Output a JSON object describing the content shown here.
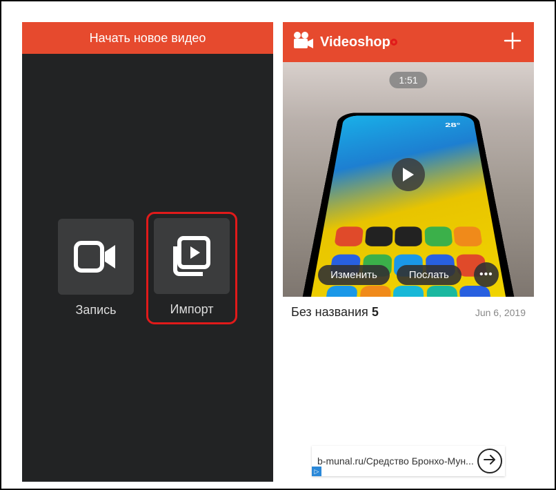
{
  "left": {
    "header_title": "Начать новое видео",
    "record_label": "Запись",
    "import_label": "Импорт"
  },
  "right": {
    "app_name": "Videoshop",
    "video": {
      "duration": "1:51",
      "edit_label": "Изменить",
      "send_label": "Послать",
      "title_prefix": "Без названия ",
      "title_number": "5",
      "date": "Jun 6, 2019",
      "weather": "28°"
    },
    "ad": {
      "text": "b-munal.ru/Средство Бронхо-Мун...",
      "badge": "▷"
    }
  }
}
